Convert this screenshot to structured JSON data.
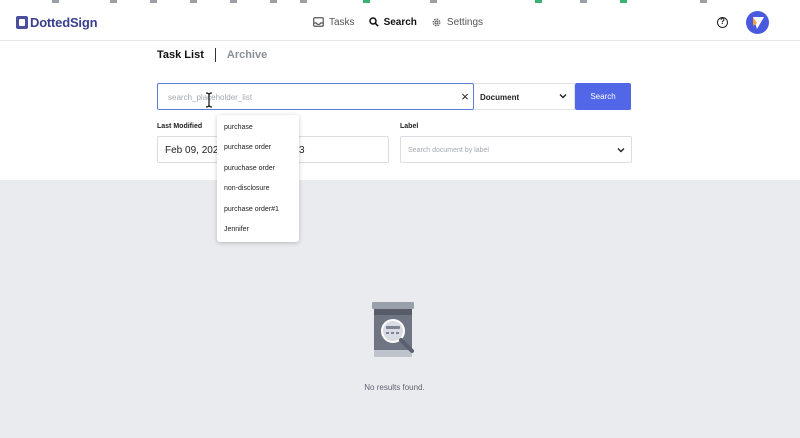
{
  "header": {
    "logo_text": "DottedSign",
    "nav": [
      {
        "label": "Tasks",
        "icon": "inbox-icon"
      },
      {
        "label": "Search",
        "icon": "search-icon"
      },
      {
        "label": "Settings",
        "icon": "gear-icon"
      }
    ],
    "help_icon": "?"
  },
  "tabs": [
    {
      "label": "Task List"
    },
    {
      "label": "Archive"
    }
  ],
  "search": {
    "placeholder": "search_placeholder_list",
    "value": "",
    "clear_icon": "×",
    "type_selected": "Document",
    "button_label": "Search",
    "suggestions": [
      "purchase",
      "purchase order",
      "puruchase order",
      "non-disclosure",
      "purchase order#1",
      "Jennifer"
    ]
  },
  "filters": {
    "last_modified_label": "Last Modified",
    "date_from": "Feb 09, 2023",
    "date_to_fragment": "3",
    "label_label": "Label",
    "label_placeholder": "Search document by label"
  },
  "results": {
    "empty_text": "No results found."
  },
  "colors": {
    "accent": "#5266e8",
    "background_results": "#e9ebef",
    "brand": "#3a3f8f"
  }
}
